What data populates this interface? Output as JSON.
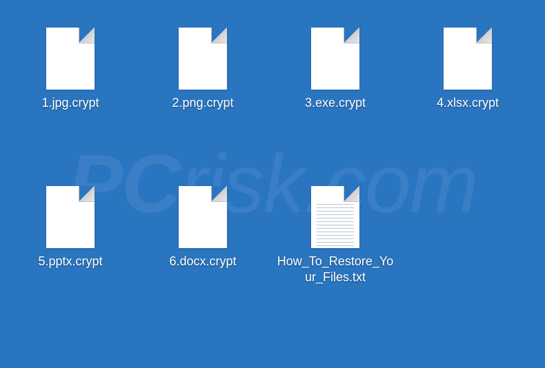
{
  "watermark": "PCrisk.com",
  "files": [
    {
      "name": "1.jpg.crypt",
      "type": "blank"
    },
    {
      "name": "2.png.crypt",
      "type": "blank"
    },
    {
      "name": "3.exe.crypt",
      "type": "blank"
    },
    {
      "name": "4.xlsx.crypt",
      "type": "blank"
    },
    {
      "name": "5.pptx.crypt",
      "type": "blank"
    },
    {
      "name": "6.docx.crypt",
      "type": "blank"
    },
    {
      "name": "How_To_Restore_Your_Files.txt",
      "type": "txt"
    }
  ]
}
